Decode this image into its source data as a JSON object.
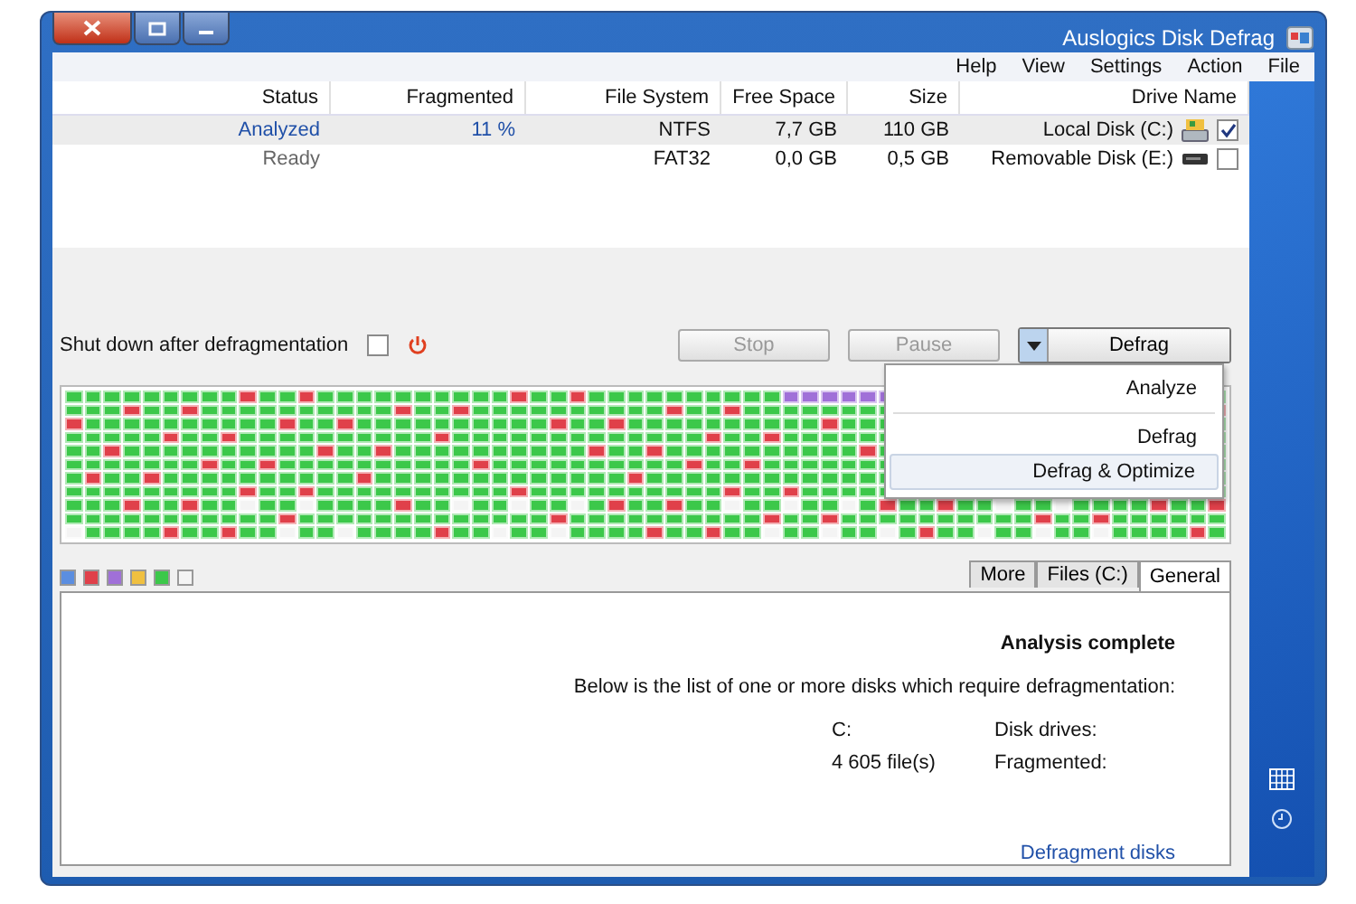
{
  "window": {
    "title": "Auslogics Disk Defrag"
  },
  "menu": [
    "Help",
    "View",
    "Settings",
    "Action",
    "File"
  ],
  "table": {
    "columns": [
      "Status",
      "Fragmented",
      "File System",
      "Free Space",
      "Size",
      "Drive Name"
    ],
    "rows": [
      {
        "checked": true,
        "selected": true,
        "kind": "local",
        "analyzed": true,
        "cells": [
          "Analyzed",
          "11 %",
          "NTFS",
          "7,7 GB",
          "110 GB",
          "Local Disk (C:)"
        ]
      },
      {
        "checked": false,
        "selected": false,
        "kind": "removable",
        "analyzed": false,
        "cells": [
          "Ready",
          "",
          "FAT32",
          "0,0 GB",
          "0,5 GB",
          "Removable Disk (E:)"
        ]
      }
    ]
  },
  "toolbar": {
    "shutdown": {
      "label": "Shut down after defragmentation",
      "checked": false
    },
    "buttons": [
      {
        "label": "Stop",
        "disabled": true
      },
      {
        "label": "Pause",
        "disabled": true
      }
    ],
    "defrag_button": {
      "label": "Defrag",
      "expanded": true
    }
  },
  "dropdown": [
    {
      "label": "Analyze",
      "selected": false
    },
    {
      "label": "Defrag",
      "selected": false
    },
    {
      "label": "Defrag & Optimize",
      "selected": true
    }
  ],
  "legend": [
    {
      "color": "#5b8ee0"
    },
    {
      "color": "#e0404a"
    },
    {
      "color": "#a070d8"
    },
    {
      "color": "#f0c040"
    },
    {
      "color": "#3cc84a"
    },
    {
      "color": "#f4f4f4"
    }
  ],
  "tabs": [
    {
      "label": "More",
      "selected": false
    },
    {
      "label": "Files (C:)",
      "selected": false
    },
    {
      "label": "General",
      "selected": true
    }
  ],
  "report": {
    "heading": "Analysis complete",
    "text": "Below is the list of one or more disks which require defragmentation:",
    "fields": [
      {
        "value": "C:",
        "label": "Disk drives:"
      },
      {
        "value": "4 605 file(s)",
        "label": "Fragmented:"
      }
    ],
    "link": "Defragment disks"
  }
}
